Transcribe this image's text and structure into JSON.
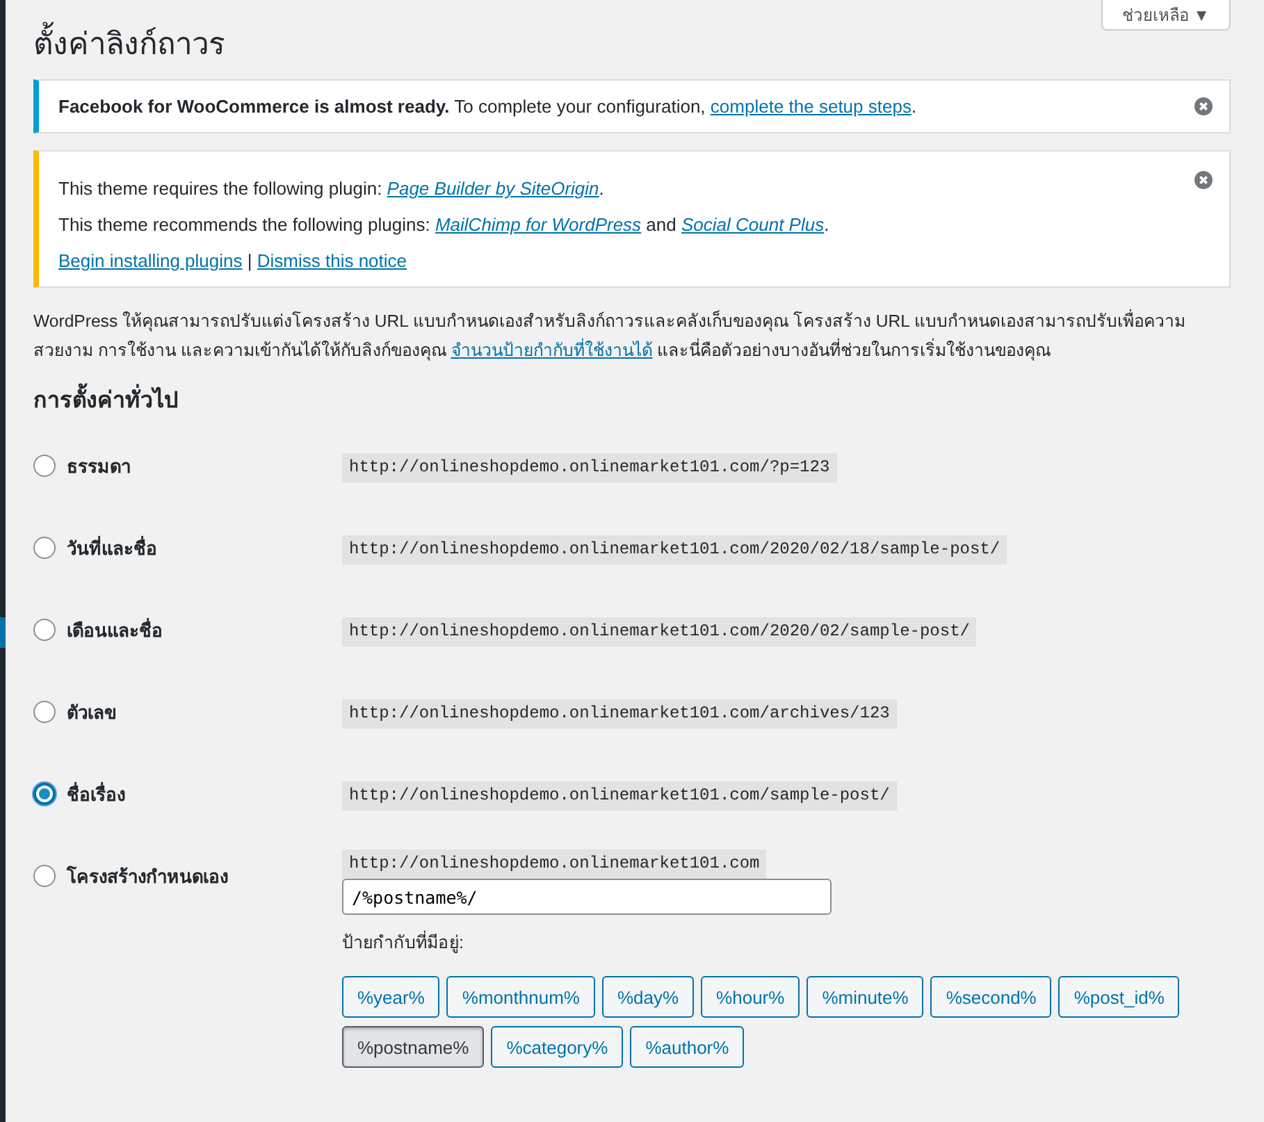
{
  "help_button": {
    "label": "ช่วยเหลือ ▼"
  },
  "title": "ตั้งค่าลิงก์ถาวร",
  "notices": [
    {
      "kind": "info",
      "dismissible": true,
      "lines": [
        [
          {
            "kind": "bold",
            "text": "Facebook for WooCommerce is almost ready."
          },
          {
            "kind": "text",
            "text": " To complete your configuration, "
          },
          {
            "kind": "link",
            "text": "complete the setup steps"
          },
          {
            "kind": "text",
            "text": "."
          }
        ]
      ]
    },
    {
      "kind": "warning",
      "dismissible": true,
      "lines": [
        [
          {
            "kind": "text",
            "text": "This theme requires the following plugin: "
          },
          {
            "kind": "italic-link",
            "text": "Page Builder by SiteOrigin"
          },
          {
            "kind": "text",
            "text": "."
          }
        ],
        [
          {
            "kind": "text",
            "text": "This theme recommends the following plugins: "
          },
          {
            "kind": "italic-link",
            "text": "MailChimp for WordPress"
          },
          {
            "kind": "text",
            "text": " and "
          },
          {
            "kind": "italic-link",
            "text": "Social Count Plus"
          },
          {
            "kind": "text",
            "text": "."
          }
        ],
        [
          {
            "kind": "link",
            "text": "Begin installing plugins"
          },
          {
            "kind": "text",
            "text": " | "
          },
          {
            "kind": "link",
            "text": "Dismiss this notice"
          }
        ]
      ]
    }
  ],
  "intro": [
    {
      "kind": "text",
      "text": "WordPress ให้คุณสามารถปรับแต่งโครงสร้าง URL แบบกำหนดเองสำหรับลิงก์ถาวรและคลังเก็บของคุณ โครงสร้าง URL แบบกำหนดเองสามารถปรับเพื่อความสวยงาม การใช้งาน และความเข้ากันได้ให้กับลิงก์ของคุณ "
    },
    {
      "kind": "link",
      "text": "จำนวนป้ายกำกับที่ใช้งานได้"
    },
    {
      "kind": "text",
      "text": " และนี่คือตัวอย่างบางอันที่ช่วยในการเริ่มใช้งานของคุณ"
    }
  ],
  "section_title": "การตั้งค่าทั่วไป",
  "options": [
    {
      "kind": "example",
      "label": "ธรรมดา",
      "selected": false,
      "example": "http://onlineshopdemo.onlinemarket101.com/?p=123"
    },
    {
      "kind": "example",
      "label": "วันที่และชื่อ",
      "selected": false,
      "example": "http://onlineshopdemo.onlinemarket101.com/2020/02/18/sample-post/"
    },
    {
      "kind": "example",
      "label": "เดือนและชื่อ",
      "selected": false,
      "example": "http://onlineshopdemo.onlinemarket101.com/2020/02/sample-post/"
    },
    {
      "kind": "example",
      "label": "ตัวเลข",
      "selected": false,
      "example": "http://onlineshopdemo.onlinemarket101.com/archives/123"
    },
    {
      "kind": "example",
      "label": "ชื่อเรื่อง",
      "selected": true,
      "example": "http://onlineshopdemo.onlinemarket101.com/sample-post/"
    },
    {
      "kind": "custom",
      "label": "โครงสร้างกำหนดเอง",
      "selected": false,
      "example": "http://onlineshopdemo.onlinemarket101.com",
      "value": "/%postname%/",
      "tags_label": "ป้ายกำกับที่มีอยู่:",
      "tags": [
        {
          "label": "%year%",
          "selected": false
        },
        {
          "label": "%monthnum%",
          "selected": false
        },
        {
          "label": "%day%",
          "selected": false
        },
        {
          "label": "%hour%",
          "selected": false
        },
        {
          "label": "%minute%",
          "selected": false
        },
        {
          "label": "%second%",
          "selected": false
        },
        {
          "label": "%post_id%",
          "selected": false
        },
        {
          "label": "%postname%",
          "selected": true
        },
        {
          "label": "%category%",
          "selected": false
        },
        {
          "label": "%author%",
          "selected": false
        }
      ]
    }
  ]
}
